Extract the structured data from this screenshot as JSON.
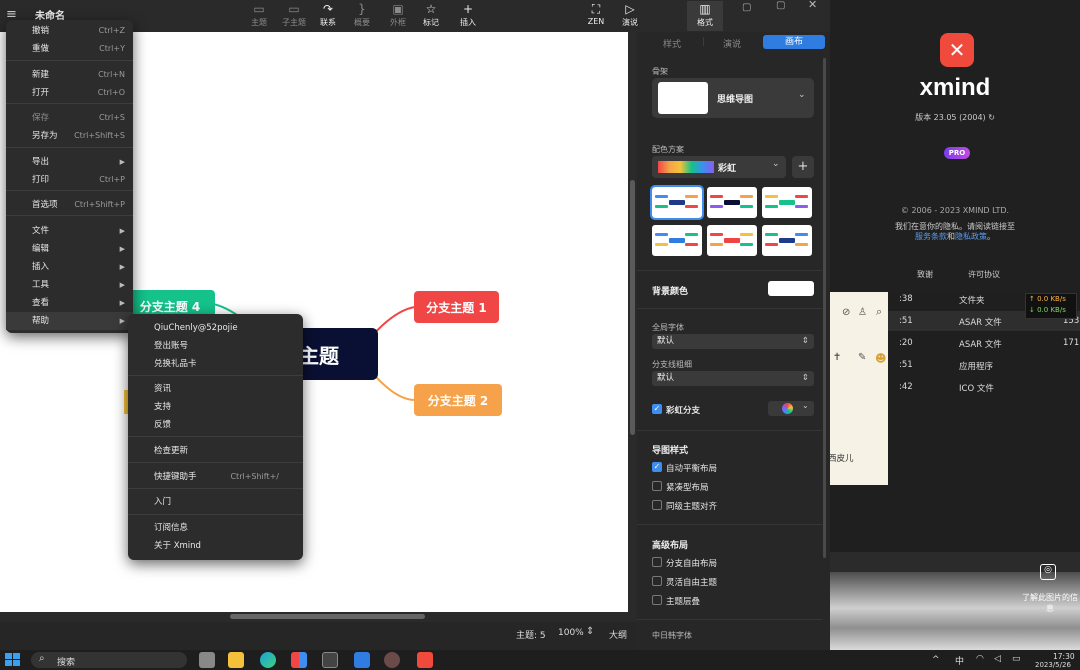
{
  "app": {
    "title": "未命名",
    "menu_icon": "hamburger-icon"
  },
  "toolbar": {
    "items": [
      {
        "label": "主题",
        "icon": "topic-icon"
      },
      {
        "label": "子主题",
        "icon": "subtopic-icon"
      },
      {
        "label": "联系",
        "icon": "relationship-icon"
      },
      {
        "label": "概要",
        "icon": "summary-icon"
      },
      {
        "label": "外框",
        "icon": "boundary-icon"
      },
      {
        "label": "标记",
        "icon": "star-icon"
      },
      {
        "label": "插入",
        "icon": "plus-icon"
      },
      {
        "label": "ZEN",
        "icon": "zen-icon"
      },
      {
        "label": "演说",
        "icon": "pitch-icon"
      },
      {
        "label": "格式",
        "icon": "format-icon"
      }
    ]
  },
  "main_menu": {
    "items": [
      {
        "label": "撤销",
        "shortcut": "Ctrl+Z"
      },
      {
        "label": "重做",
        "shortcut": "Ctrl+Y"
      },
      {
        "label": "新建",
        "shortcut": "Ctrl+N"
      },
      {
        "label": "打开",
        "shortcut": "Ctrl+O"
      },
      {
        "label": "保存",
        "shortcut": "Ctrl+S"
      },
      {
        "label": "另存为",
        "shortcut": "Ctrl+Shift+S"
      },
      {
        "label": "导出",
        "shortcut": ""
      },
      {
        "label": "打印",
        "shortcut": "Ctrl+P"
      },
      {
        "label": "首选项",
        "shortcut": "Ctrl+Shift+P"
      },
      {
        "label": "文件",
        "shortcut": ""
      },
      {
        "label": "编辑",
        "shortcut": ""
      },
      {
        "label": "插入",
        "shortcut": ""
      },
      {
        "label": "工具",
        "shortcut": ""
      },
      {
        "label": "查看",
        "shortcut": ""
      },
      {
        "label": "帮助",
        "shortcut": ""
      }
    ]
  },
  "help_menu": {
    "items": [
      {
        "label": "QiuChenly@52pojie",
        "shortcut": ""
      },
      {
        "label": "登出账号",
        "shortcut": ""
      },
      {
        "label": "兑换礼品卡",
        "shortcut": ""
      },
      {
        "label": "资讯",
        "shortcut": ""
      },
      {
        "label": "支持",
        "shortcut": ""
      },
      {
        "label": "反馈",
        "shortcut": ""
      },
      {
        "label": "检查更新",
        "shortcut": ""
      },
      {
        "label": "快捷键助手",
        "shortcut": "Ctrl+Shift+/"
      },
      {
        "label": "入门",
        "shortcut": ""
      },
      {
        "label": "订阅信息",
        "shortcut": ""
      },
      {
        "label": "关于 Xmind",
        "shortcut": ""
      }
    ]
  },
  "map": {
    "central": "心主题",
    "branches": [
      "分支主题 1",
      "分支主题 2",
      "分支主题 4"
    ],
    "colors": {
      "central": "#0a1033",
      "b1": "#f04646",
      "b2": "#f5a24a",
      "b4": "#14c28a"
    }
  },
  "status": {
    "topics": "主题: 5",
    "zoom": "100%",
    "outline": "大纲"
  },
  "panel": {
    "tabs": [
      "样式",
      "演说",
      "画布"
    ],
    "skeleton_label": "骨架",
    "skeleton_value": "思维导图",
    "scheme_label": "配色方案",
    "scheme_value": "彩虹",
    "bg_color_label": "背景颜色",
    "global_font_label": "全局字体",
    "global_font_value": "默认",
    "branch_thickness_label": "分支线粗细",
    "branch_thickness_value": "默认",
    "rainbow_branch": "彩虹分支",
    "map_style_label": "导图样式",
    "map_style_options": [
      {
        "label": "自动平衡布局",
        "checked": true
      },
      {
        "label": "紧凑型布局",
        "checked": false
      },
      {
        "label": "同级主题对齐",
        "checked": false
      }
    ],
    "advanced_label": "高级布局",
    "advanced_options": [
      {
        "label": "分支自由布局",
        "checked": false
      },
      {
        "label": "灵活自由主题",
        "checked": false
      },
      {
        "label": "主题层叠",
        "checked": false
      }
    ],
    "cjk_font_label": "中日韩字体"
  },
  "about": {
    "logo_text": "xmind",
    "version": "版本 23.05 (2004)",
    "badge": "PRO",
    "copyright": "© 2006 - 2023 XMIND LTD.",
    "privacy_line": "我们在意你的隐私。请阅读链接至",
    "link_terms": "服务条款",
    "link_and": "和",
    "link_privacy": "隐私政策",
    "link_end": "。",
    "btn_thanks": "致谢",
    "btn_license": "许可协议"
  },
  "explorer": {
    "rows": [
      {
        "time": ":38",
        "type": "文件夹",
        "size": ""
      },
      {
        "time": ":51",
        "type": "ASAR 文件",
        "size": "153"
      },
      {
        "time": ":20",
        "type": "ASAR 文件",
        "size": "171"
      },
      {
        "time": ":51",
        "type": "应用程序",
        "size": ""
      },
      {
        "time": ":42",
        "type": "ICO 文件",
        "size": ""
      }
    ],
    "net_up": "↑ 0.0 KB/s",
    "net_down": "↓ 0.0 KB/s",
    "note_text": "西皮儿",
    "learn_more": "了解此图片的信息"
  },
  "taskbar": {
    "search": "搜索",
    "time": "17:30",
    "date": "2023/5/26",
    "lang": "中"
  }
}
